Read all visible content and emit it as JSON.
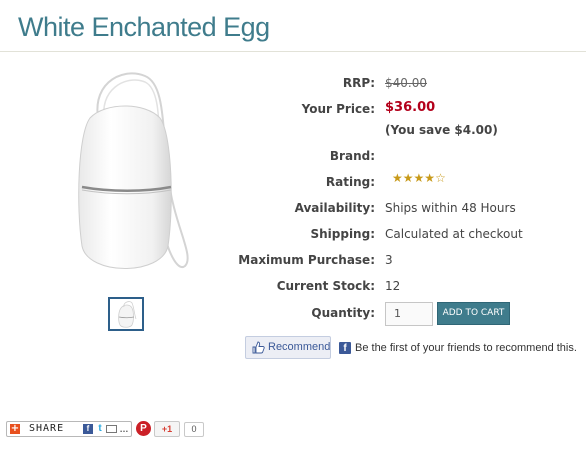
{
  "product": {
    "title": "White Enchanted Egg",
    "image_alt": "White egg vibrator with cord"
  },
  "details": {
    "rrp_label": "RRP:",
    "rrp_value": "$40.00",
    "price_label": "Your Price:",
    "price_value": "$36.00",
    "savings": "(You save $4.00)",
    "brand_label": "Brand:",
    "brand_value": "",
    "rating_label": "Rating:",
    "rating_value": 4,
    "rating_max": 5,
    "availability_label": "Availability:",
    "availability_value": "Ships within 48 Hours",
    "shipping_label": "Shipping:",
    "shipping_value": "Calculated at checkout",
    "max_purchase_label": "Maximum Purchase:",
    "max_purchase_value": "3",
    "stock_label": "Current Stock:",
    "stock_value": "12",
    "quantity_label": "Quantity:",
    "quantity_value": "1"
  },
  "buttons": {
    "add_to_cart": "ADD TO CART",
    "recommend": "Recommend"
  },
  "social": {
    "facebook_text": "Be the first of your friends to recommend this.",
    "share_label": "SHARE",
    "gplus_label": "+1",
    "gplus_count": "0"
  },
  "colors": {
    "title": "#3f7c8c",
    "price": "#b3001b",
    "cart_button": "#3f7c8c",
    "star": "#c89a1a"
  }
}
